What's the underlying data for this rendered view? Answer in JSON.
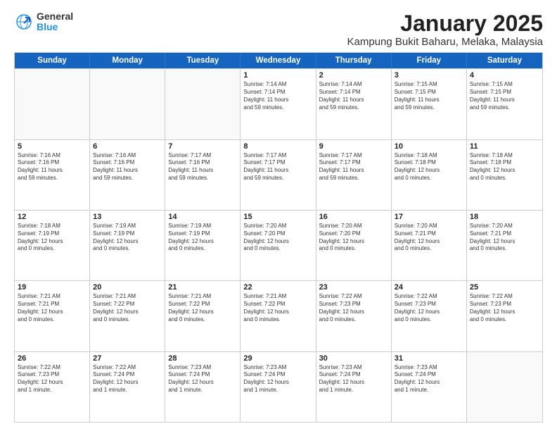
{
  "logo": {
    "general": "General",
    "blue": "Blue"
  },
  "title": {
    "month": "January 2025",
    "location": "Kampung Bukit Baharu, Melaka, Malaysia"
  },
  "calendar": {
    "headers": [
      "Sunday",
      "Monday",
      "Tuesday",
      "Wednesday",
      "Thursday",
      "Friday",
      "Saturday"
    ],
    "weeks": [
      [
        {
          "day": "",
          "info": "",
          "empty": true
        },
        {
          "day": "",
          "info": "",
          "empty": true
        },
        {
          "day": "",
          "info": "",
          "empty": true
        },
        {
          "day": "1",
          "info": "Sunrise: 7:14 AM\nSunset: 7:14 PM\nDaylight: 11 hours\nand 59 minutes.",
          "empty": false
        },
        {
          "day": "2",
          "info": "Sunrise: 7:14 AM\nSunset: 7:14 PM\nDaylight: 11 hours\nand 59 minutes.",
          "empty": false
        },
        {
          "day": "3",
          "info": "Sunrise: 7:15 AM\nSunset: 7:15 PM\nDaylight: 11 hours\nand 59 minutes.",
          "empty": false
        },
        {
          "day": "4",
          "info": "Sunrise: 7:15 AM\nSunset: 7:15 PM\nDaylight: 11 hours\nand 59 minutes.",
          "empty": false
        }
      ],
      [
        {
          "day": "5",
          "info": "Sunrise: 7:16 AM\nSunset: 7:16 PM\nDaylight: 11 hours\nand 59 minutes.",
          "empty": false
        },
        {
          "day": "6",
          "info": "Sunrise: 7:16 AM\nSunset: 7:16 PM\nDaylight: 11 hours\nand 59 minutes.",
          "empty": false
        },
        {
          "day": "7",
          "info": "Sunrise: 7:17 AM\nSunset: 7:16 PM\nDaylight: 11 hours\nand 59 minutes.",
          "empty": false
        },
        {
          "day": "8",
          "info": "Sunrise: 7:17 AM\nSunset: 7:17 PM\nDaylight: 11 hours\nand 59 minutes.",
          "empty": false
        },
        {
          "day": "9",
          "info": "Sunrise: 7:17 AM\nSunset: 7:17 PM\nDaylight: 11 hours\nand 59 minutes.",
          "empty": false
        },
        {
          "day": "10",
          "info": "Sunrise: 7:18 AM\nSunset: 7:18 PM\nDaylight: 12 hours\nand 0 minutes.",
          "empty": false
        },
        {
          "day": "11",
          "info": "Sunrise: 7:18 AM\nSunset: 7:18 PM\nDaylight: 12 hours\nand 0 minutes.",
          "empty": false
        }
      ],
      [
        {
          "day": "12",
          "info": "Sunrise: 7:18 AM\nSunset: 7:19 PM\nDaylight: 12 hours\nand 0 minutes.",
          "empty": false
        },
        {
          "day": "13",
          "info": "Sunrise: 7:19 AM\nSunset: 7:19 PM\nDaylight: 12 hours\nand 0 minutes.",
          "empty": false
        },
        {
          "day": "14",
          "info": "Sunrise: 7:19 AM\nSunset: 7:19 PM\nDaylight: 12 hours\nand 0 minutes.",
          "empty": false
        },
        {
          "day": "15",
          "info": "Sunrise: 7:20 AM\nSunset: 7:20 PM\nDaylight: 12 hours\nand 0 minutes.",
          "empty": false
        },
        {
          "day": "16",
          "info": "Sunrise: 7:20 AM\nSunset: 7:20 PM\nDaylight: 12 hours\nand 0 minutes.",
          "empty": false
        },
        {
          "day": "17",
          "info": "Sunrise: 7:20 AM\nSunset: 7:21 PM\nDaylight: 12 hours\nand 0 minutes.",
          "empty": false
        },
        {
          "day": "18",
          "info": "Sunrise: 7:20 AM\nSunset: 7:21 PM\nDaylight: 12 hours\nand 0 minutes.",
          "empty": false
        }
      ],
      [
        {
          "day": "19",
          "info": "Sunrise: 7:21 AM\nSunset: 7:21 PM\nDaylight: 12 hours\nand 0 minutes.",
          "empty": false
        },
        {
          "day": "20",
          "info": "Sunrise: 7:21 AM\nSunset: 7:22 PM\nDaylight: 12 hours\nand 0 minutes.",
          "empty": false
        },
        {
          "day": "21",
          "info": "Sunrise: 7:21 AM\nSunset: 7:22 PM\nDaylight: 12 hours\nand 0 minutes.",
          "empty": false
        },
        {
          "day": "22",
          "info": "Sunrise: 7:21 AM\nSunset: 7:22 PM\nDaylight: 12 hours\nand 0 minutes.",
          "empty": false
        },
        {
          "day": "23",
          "info": "Sunrise: 7:22 AM\nSunset: 7:23 PM\nDaylight: 12 hours\nand 0 minutes.",
          "empty": false
        },
        {
          "day": "24",
          "info": "Sunrise: 7:22 AM\nSunset: 7:23 PM\nDaylight: 12 hours\nand 0 minutes.",
          "empty": false
        },
        {
          "day": "25",
          "info": "Sunrise: 7:22 AM\nSunset: 7:23 PM\nDaylight: 12 hours\nand 0 minutes.",
          "empty": false
        }
      ],
      [
        {
          "day": "26",
          "info": "Sunrise: 7:22 AM\nSunset: 7:23 PM\nDaylight: 12 hours\nand 1 minute.",
          "empty": false
        },
        {
          "day": "27",
          "info": "Sunrise: 7:22 AM\nSunset: 7:24 PM\nDaylight: 12 hours\nand 1 minute.",
          "empty": false
        },
        {
          "day": "28",
          "info": "Sunrise: 7:23 AM\nSunset: 7:24 PM\nDaylight: 12 hours\nand 1 minute.",
          "empty": false
        },
        {
          "day": "29",
          "info": "Sunrise: 7:23 AM\nSunset: 7:24 PM\nDaylight: 12 hours\nand 1 minute.",
          "empty": false
        },
        {
          "day": "30",
          "info": "Sunrise: 7:23 AM\nSunset: 7:24 PM\nDaylight: 12 hours\nand 1 minute.",
          "empty": false
        },
        {
          "day": "31",
          "info": "Sunrise: 7:23 AM\nSunset: 7:24 PM\nDaylight: 12 hours\nand 1 minute.",
          "empty": false
        },
        {
          "day": "",
          "info": "",
          "empty": true
        }
      ]
    ]
  }
}
